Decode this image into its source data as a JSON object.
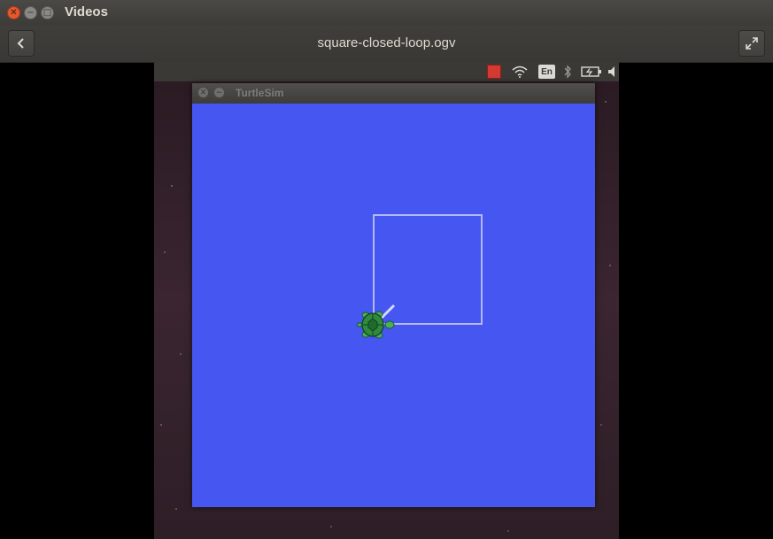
{
  "window": {
    "title": "Videos",
    "controls": [
      "close-icon",
      "minimize-icon",
      "maximize-icon"
    ]
  },
  "header": {
    "back_icon": "back-arrow-icon",
    "file_name": "square-closed-loop.ogv",
    "fullscreen_icon": "fullscreen-icon"
  },
  "video_panel": {
    "tray_icons": [
      "record-indicator-icon",
      "wifi-icon",
      "keyboard-language-icon",
      "bluetooth-icon",
      "battery-icon",
      "volume-icon"
    ],
    "keyboard_language": "En"
  },
  "turtlesim": {
    "title": "TurtleSim",
    "controls": [
      "close-icon",
      "minimize-icon"
    ],
    "background_color": "#4656f0",
    "pen_color": "#b3b8f5",
    "turtle_color": "#2e8b3e"
  },
  "colors": {
    "close_button": "#e3582f",
    "recording_indicator": "#d23a32"
  }
}
